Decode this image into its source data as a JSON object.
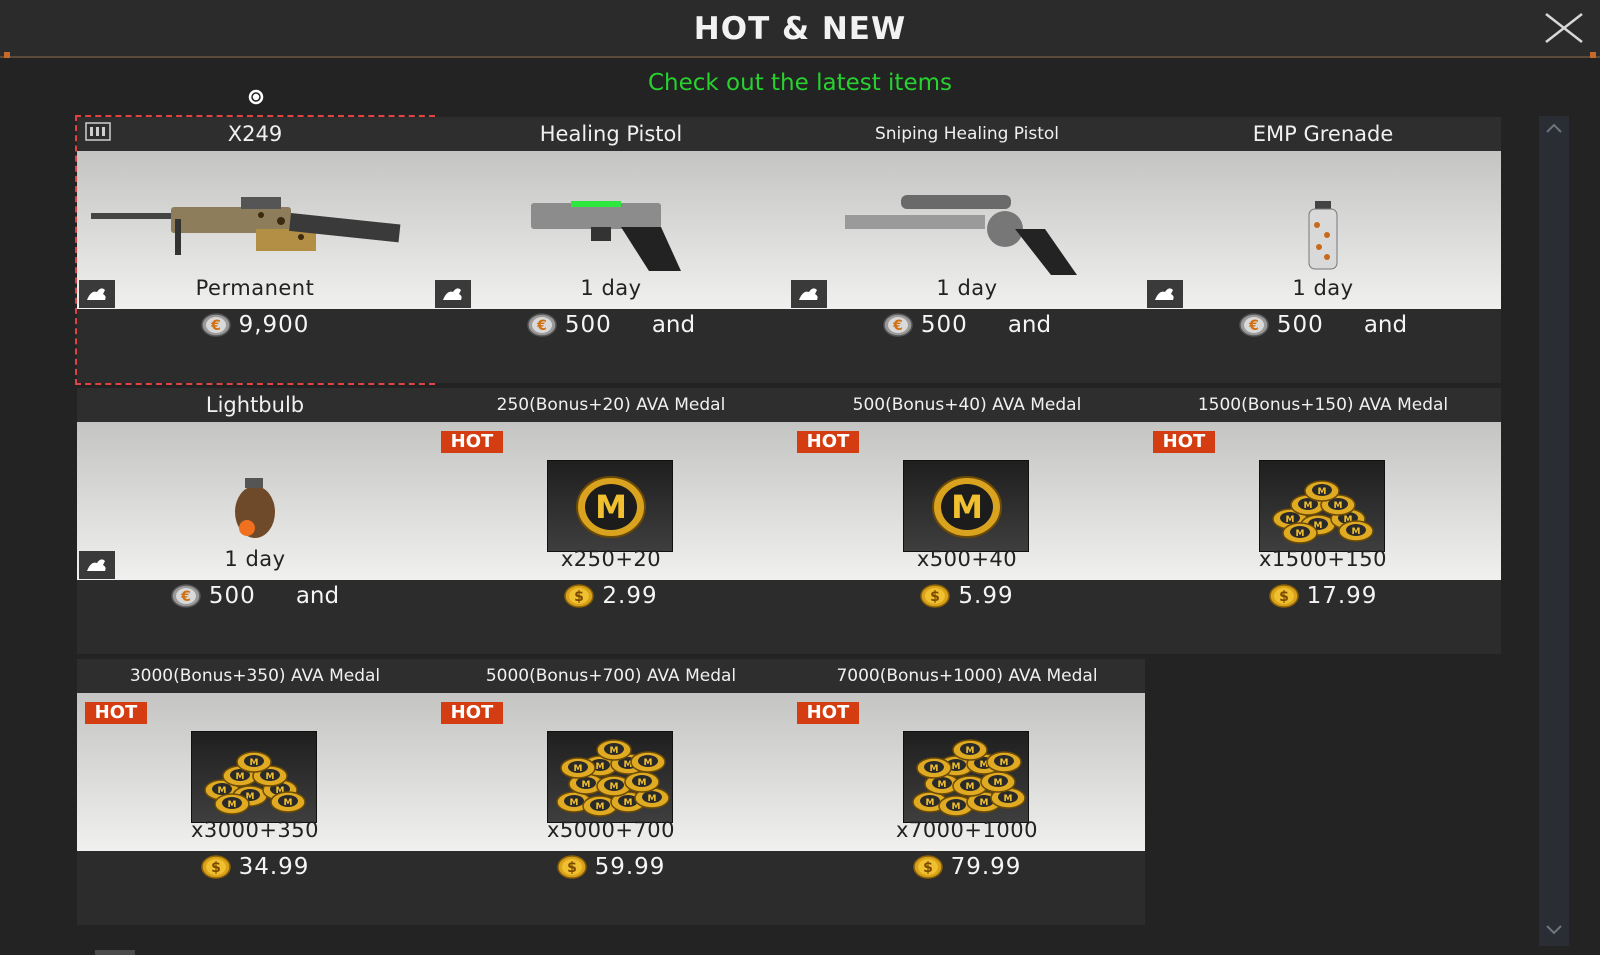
{
  "window": {
    "title": "HOT & NEW",
    "subtitle": "Check out the latest items",
    "close_icon": "close-x-icon",
    "accent_color": "#c8682a",
    "subtitle_color": "#27d22f"
  },
  "items": [
    {
      "name": "X249",
      "duration": "Permanent",
      "currency": "euro-coin-icon",
      "price": "9,900",
      "and": "",
      "hot": false,
      "gift": true,
      "bundle_icon": true,
      "art": "machine-gun"
    },
    {
      "name": "Healing Pistol",
      "duration": "1 day",
      "currency": "euro-coin-icon",
      "price": "500",
      "and": "and",
      "hot": false,
      "gift": true,
      "art": "pistol"
    },
    {
      "name": "Sniping Healing Pistol",
      "duration": "1 day",
      "currency": "euro-coin-icon",
      "price": "500",
      "and": "and",
      "hot": false,
      "gift": true,
      "art": "revolver"
    },
    {
      "name": "EMP Grenade",
      "duration": "1 day",
      "currency": "euro-coin-icon",
      "price": "500",
      "and": "and",
      "hot": false,
      "gift": true,
      "art": "canister"
    },
    {
      "name": "Lightbulb",
      "duration": "1 day",
      "currency": "euro-coin-icon",
      "price": "500",
      "and": "and",
      "hot": false,
      "gift": true,
      "art": "grenade"
    },
    {
      "name": "250(Bonus+20) AVA Medal",
      "duration": "x250+20",
      "currency": "dollar-coin-icon",
      "price": "2.99",
      "and": "",
      "hot": true,
      "hot_label": "HOT",
      "art": "medal-single"
    },
    {
      "name": "500(Bonus+40) AVA Medal",
      "duration": "x500+40",
      "currency": "dollar-coin-icon",
      "price": "5.99",
      "and": "",
      "hot": true,
      "hot_label": "HOT",
      "art": "medal-single"
    },
    {
      "name": "1500(Bonus+150) AVA Medal",
      "duration": "x1500+150",
      "currency": "dollar-coin-icon",
      "price": "17.99",
      "and": "",
      "hot": true,
      "hot_label": "HOT",
      "art": "medal-pile"
    },
    {
      "name": "3000(Bonus+350) AVA Medal",
      "duration": "x3000+350",
      "currency": "dollar-coin-icon",
      "price": "34.99",
      "and": "",
      "hot": true,
      "hot_label": "HOT",
      "art": "medal-pile"
    },
    {
      "name": "5000(Bonus+700) AVA Medal",
      "duration": "x5000+700",
      "currency": "dollar-coin-icon",
      "price": "59.99",
      "and": "",
      "hot": true,
      "hot_label": "HOT",
      "art": "medal-heap"
    },
    {
      "name": "7000(Bonus+1000) AVA Medal",
      "duration": "x7000+1000",
      "currency": "dollar-coin-icon",
      "price": "79.99",
      "and": "",
      "hot": true,
      "hot_label": "HOT",
      "art": "medal-heap"
    }
  ],
  "scrollbar": {
    "up_icon": "chevron-up-icon",
    "down_icon": "chevron-down-icon"
  }
}
